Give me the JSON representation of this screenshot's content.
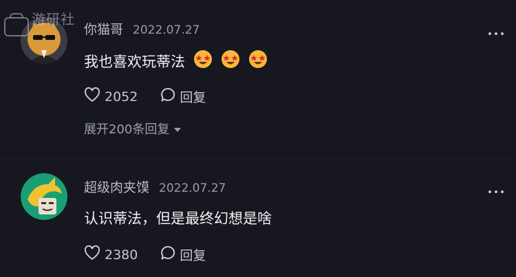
{
  "watermark": {
    "text": "游研社"
  },
  "comments": [
    {
      "username": "你猫哥",
      "date": "2022.07.27",
      "text": "我也喜欢玩蒂法",
      "emoji_icons": [
        "star-struck-emoji-icon",
        "star-struck-emoji-icon",
        "star-struck-emoji-icon"
      ],
      "likes": "2052",
      "reply_label": "回复",
      "expand_label": "展开200条回复"
    },
    {
      "username": "超级肉夹馍",
      "date": "2022.07.27",
      "text": "认识蒂法，但是最终幻想是啥",
      "likes": "2380",
      "reply_label": "回复"
    }
  ],
  "colors": {
    "background": "#16171f",
    "username": "#b9bac3",
    "text": "#f1f1f4",
    "secondary": "#9fa0aa",
    "avatar2_bg": "#1a9e73"
  }
}
